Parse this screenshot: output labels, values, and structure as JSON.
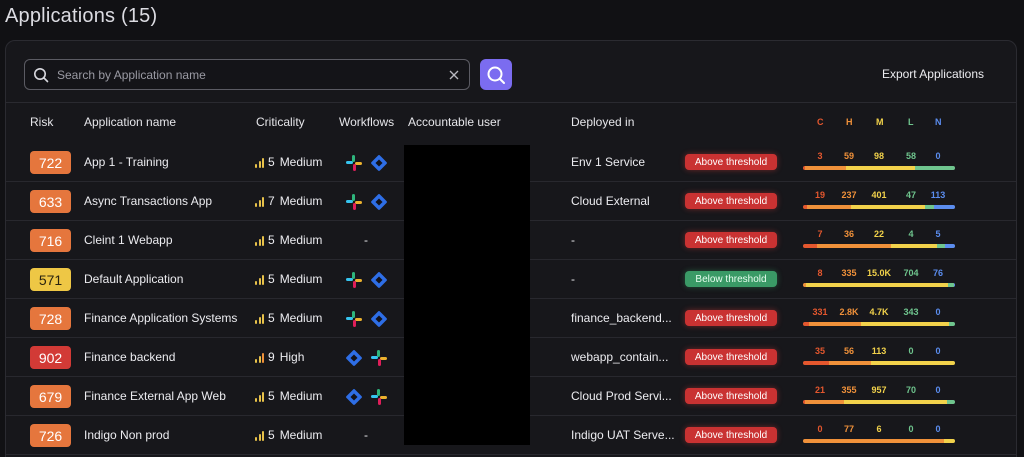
{
  "page": {
    "title": "Applications (15)"
  },
  "search": {
    "placeholder": "Search by Application name",
    "value": ""
  },
  "toolbar": {
    "export_label": "Export Applications"
  },
  "columns": {
    "risk": "Risk",
    "application_name": "Application name",
    "criticality": "Criticality",
    "workflows": "Workflows",
    "accountable_user": "Accountable user",
    "deployed_in": "Deployed in"
  },
  "severity_labels": [
    {
      "key": "C",
      "color": "#e4572e"
    },
    {
      "key": "H",
      "color": "#f0913a"
    },
    {
      "key": "M",
      "color": "#f2d24b"
    },
    {
      "key": "L",
      "color": "#6fc58e"
    },
    {
      "key": "N",
      "color": "#5b8def"
    }
  ],
  "rows": [
    {
      "risk": "722",
      "risk_color": "#e5763d",
      "name": "App 1 - Training",
      "crit_num": "5",
      "crit_label": "Medium",
      "workflows": [
        "slack",
        "jira"
      ],
      "workflow_dash": "",
      "deployed": "Env 1 Service",
      "threshold": "Above threshold",
      "threshold_state": "above",
      "sev": [
        "3",
        "59",
        "98",
        "58",
        "0"
      ],
      "bar": [
        3,
        59,
        98,
        58,
        0
      ]
    },
    {
      "risk": "633",
      "risk_color": "#e5763d",
      "name": "Async Transactions App",
      "crit_num": "7",
      "crit_label": "Medium",
      "workflows": [
        "slack",
        "jira"
      ],
      "workflow_dash": "",
      "deployed": "Cloud External",
      "threshold": "Above threshold",
      "threshold_state": "above",
      "sev": [
        "19",
        "237",
        "401",
        "47",
        "113"
      ],
      "bar": [
        19,
        237,
        401,
        47,
        113
      ]
    },
    {
      "risk": "716",
      "risk_color": "#e5763d",
      "name": "Cleint 1 Webapp",
      "crit_num": "5",
      "crit_label": "Medium",
      "workflows": [],
      "workflow_dash": "-",
      "deployed": "-",
      "threshold": "Above threshold",
      "threshold_state": "above",
      "sev": [
        "7",
        "36",
        "22",
        "4",
        "5"
      ],
      "bar": [
        7,
        36,
        22,
        4,
        5
      ]
    },
    {
      "risk": "571",
      "risk_color": "#eec745",
      "name": "Default Application",
      "crit_num": "5",
      "crit_label": "Medium",
      "workflows": [
        "slack",
        "jira"
      ],
      "workflow_dash": "",
      "deployed": "-",
      "threshold": "Below threshold",
      "threshold_state": "below",
      "sev": [
        "8",
        "335",
        "15.0K",
        "704",
        "76"
      ],
      "bar": [
        8,
        335,
        15000,
        704,
        76
      ]
    },
    {
      "risk": "728",
      "risk_color": "#e5763d",
      "name": "Finance Application Systems",
      "crit_num": "5",
      "crit_label": "Medium",
      "workflows": [
        "slack",
        "jira"
      ],
      "workflow_dash": "",
      "deployed": "finance_backend...",
      "threshold": "Above threshold",
      "threshold_state": "above",
      "sev": [
        "331",
        "2.8K",
        "4.7K",
        "343",
        "0"
      ],
      "bar": [
        331,
        2800,
        4700,
        343,
        0
      ]
    },
    {
      "risk": "902",
      "risk_color": "#d23a36",
      "name": "Finance backend",
      "crit_num": "9",
      "crit_label": "High",
      "workflows": [
        "jira",
        "slack"
      ],
      "workflow_dash": "",
      "deployed": "webapp_contain...",
      "threshold": "Above threshold",
      "threshold_state": "above",
      "sev": [
        "35",
        "56",
        "113",
        "0",
        "0"
      ],
      "bar": [
        35,
        56,
        113,
        0,
        0
      ]
    },
    {
      "risk": "679",
      "risk_color": "#e5763d",
      "name": "Finance External App Web",
      "crit_num": "5",
      "crit_label": "Medium",
      "workflows": [
        "jira",
        "slack"
      ],
      "workflow_dash": "",
      "deployed": "Cloud Prod Servi...",
      "threshold": "Above threshold",
      "threshold_state": "above",
      "sev": [
        "21",
        "355",
        "957",
        "70",
        "0"
      ],
      "bar": [
        21,
        355,
        957,
        70,
        0
      ]
    },
    {
      "risk": "726",
      "risk_color": "#e5763d",
      "name": "Indigo Non prod",
      "crit_num": "5",
      "crit_label": "Medium",
      "workflows": [],
      "workflow_dash": "-",
      "deployed": "Indigo UAT Serve...",
      "threshold": "Above threshold",
      "threshold_state": "above",
      "sev": [
        "0",
        "77",
        "6",
        "0",
        "0"
      ],
      "bar": [
        0,
        77,
        6,
        0,
        0
      ]
    }
  ]
}
